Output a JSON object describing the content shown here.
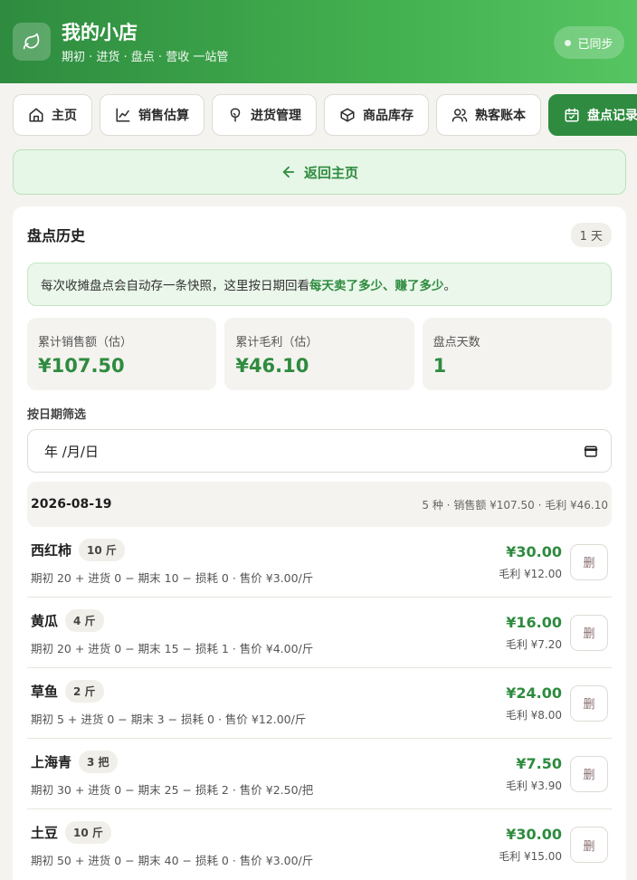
{
  "header": {
    "title": "我的小店",
    "subtitle": "期初 · 进货 · 盘点 · 营收 一站管",
    "sync_label": "已同步"
  },
  "tabs": [
    {
      "label": "主页",
      "icon": "home-icon"
    },
    {
      "label": "销售估算",
      "icon": "chart-line-icon"
    },
    {
      "label": "进货管理",
      "icon": "sprout-icon"
    },
    {
      "label": "商品库存",
      "icon": "box-icon"
    },
    {
      "label": "熟客账本",
      "icon": "users-icon"
    },
    {
      "label": "盘点记录",
      "icon": "calendar-check-icon",
      "active": true
    }
  ],
  "back_button": {
    "label": "返回主页"
  },
  "history": {
    "title": "盘点历史",
    "day_badge": "1 天",
    "info_prefix": "每次收摊盘点会自动存一条快照，这里按日期回看",
    "info_highlight": "每天卖了多少、赚了多少",
    "info_suffix": "。",
    "stats": [
      {
        "label": "累计销售额（估）",
        "value": "¥107.50"
      },
      {
        "label": "累计毛利（估）",
        "value": "¥46.10"
      },
      {
        "label": "盘点天数",
        "value": "1"
      }
    ],
    "filter_label": "按日期筛选",
    "date_placeholder": "年 /月/日",
    "group": {
      "date": "2026-08-19",
      "summary": "5 种 · 销售额 ¥107.50 · 毛利 ¥46.10"
    },
    "items": [
      {
        "name": "西红柿",
        "qty": "10 斤",
        "formula": "期初 20 + 进货 0 − 期末 10 − 损耗 0 · 售价 ¥3.00/斤",
        "amount": "¥30.00",
        "profit": "毛利 ¥12.00",
        "delete_label": "删"
      },
      {
        "name": "黄瓜",
        "qty": "4 斤",
        "formula": "期初 20 + 进货 0 − 期末 15 − 损耗 1 · 售价 ¥4.00/斤",
        "amount": "¥16.00",
        "profit": "毛利 ¥7.20",
        "delete_label": "删"
      },
      {
        "name": "草鱼",
        "qty": "2 斤",
        "formula": "期初 5 + 进货 0 − 期末 3 − 损耗 0 · 售价 ¥12.00/斤",
        "amount": "¥24.00",
        "profit": "毛利 ¥8.00",
        "delete_label": "删"
      },
      {
        "name": "上海青",
        "qty": "3 把",
        "formula": "期初 30 + 进货 0 − 期末 25 − 损耗 2 · 售价 ¥2.50/把",
        "amount": "¥7.50",
        "profit": "毛利 ¥3.90",
        "delete_label": "删"
      },
      {
        "name": "土豆",
        "qty": "10 斤",
        "formula": "期初 50 + 进货 0 − 期末 40 − 损耗 0 · 售价 ¥3.00/斤",
        "amount": "¥30.00",
        "profit": "毛利 ¥15.00",
        "delete_label": "删"
      }
    ]
  },
  "colors": {
    "accent": "#2e8b3f",
    "accent_light": "#e6f6e7",
    "background": "#f4f3ef"
  }
}
